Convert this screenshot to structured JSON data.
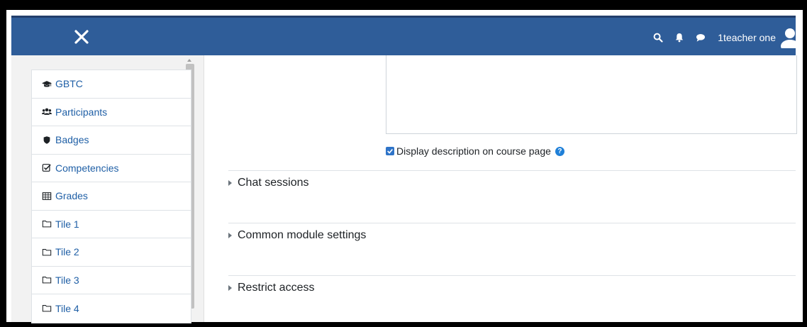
{
  "header": {
    "close_icon": "close-icon",
    "icons": [
      "search-icon",
      "bell-icon",
      "chat-icon"
    ],
    "user_name": "1teacher one",
    "brand_color": "#2f5d99"
  },
  "sidebar": {
    "items": [
      {
        "label": "GBTC",
        "icon": "graduation-cap-icon"
      },
      {
        "label": "Participants",
        "icon": "users-icon"
      },
      {
        "label": "Badges",
        "icon": "shield-icon"
      },
      {
        "label": "Competencies",
        "icon": "check-square-icon"
      },
      {
        "label": "Grades",
        "icon": "table-icon"
      },
      {
        "label": "Tile 1",
        "icon": "folder-icon"
      },
      {
        "label": "Tile 2",
        "icon": "folder-icon"
      },
      {
        "label": "Tile 3",
        "icon": "folder-icon"
      },
      {
        "label": "Tile 4",
        "icon": "folder-icon"
      }
    ]
  },
  "main": {
    "display_description_label": "Display description on course page",
    "display_description_checked": true,
    "sections": [
      {
        "label": "Chat sessions"
      },
      {
        "label": "Common module settings"
      },
      {
        "label": "Restrict access"
      }
    ]
  }
}
